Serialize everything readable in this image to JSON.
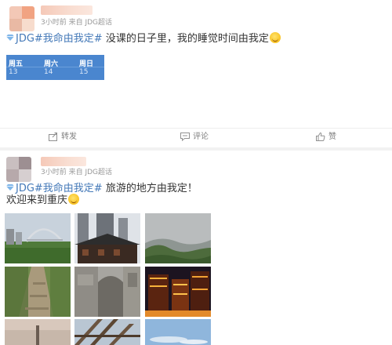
{
  "colors": {
    "topic": "#4479b8",
    "meta": "#999999",
    "action": "#808080",
    "calendar": "#4a86cf"
  },
  "posts": [
    {
      "meta": "3小时前  来自 JDG超话",
      "topic": "JDG#我命由我定#",
      "text": " 没课的日子里，我的睡觉时间由我定",
      "emoji_name": "grinning-emoji",
      "calendar": [
        {
          "day": "周五",
          "date": "13"
        },
        {
          "day": "周六",
          "date": "14"
        },
        {
          "day": "周日",
          "date": "15"
        }
      ],
      "actions": {
        "repost": "转发",
        "comment": "评论",
        "like": "赞"
      }
    },
    {
      "meta": "3小时前  来自 JDG超话",
      "topic": "JDG#我命由我定#",
      "text": " 旅游的地方由我定！",
      "line2": "欢迎来到重庆",
      "emoji_name": "grinning-emoji",
      "photos": [
        "bridge-skyline-photo",
        "pagoda-building-photo",
        "misty-mountain-photo",
        "mountain-path-photo",
        "stone-gate-photo",
        "night-lights-photo",
        "pillar-sky-photo",
        "wooden-structure-photo",
        "clear-sky-photo"
      ]
    }
  ]
}
